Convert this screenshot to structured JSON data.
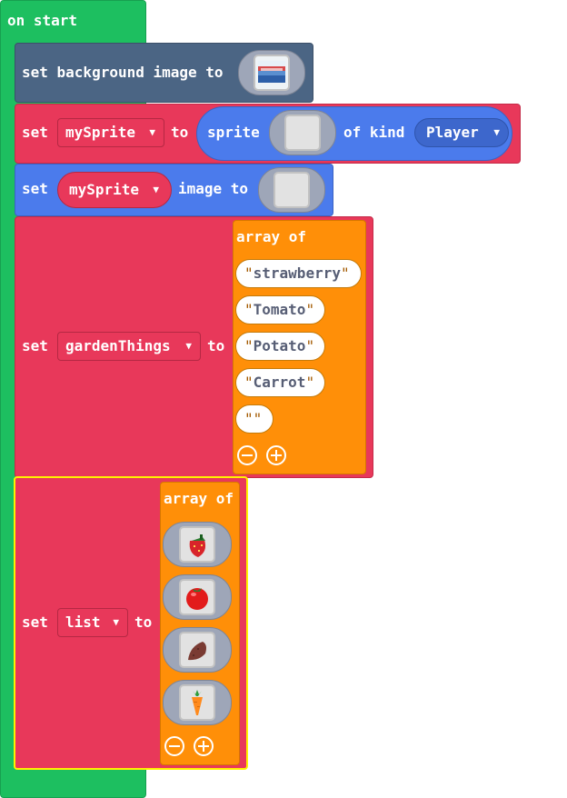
{
  "hat": {
    "label": "on start"
  },
  "bg_block": {
    "label": "set background image to",
    "image_icon": "image-thumbnail-icon"
  },
  "sprite_block": {
    "set": "set",
    "var": "mySprite",
    "to": "to",
    "sprite": "sprite",
    "of_kind": "of kind",
    "kind": "Player"
  },
  "image_block": {
    "set": "set",
    "var": "mySprite",
    "image_to": "image to"
  },
  "garden_block": {
    "set": "set",
    "var": "gardenThings",
    "to": "to",
    "array_label": "array of",
    "items": [
      "strawberry",
      "Tomato",
      "Potato",
      "Carrot",
      ""
    ]
  },
  "list_block": {
    "set": "set",
    "var": "list",
    "to": "to",
    "array_label": "array of",
    "images": [
      "strawberry-icon",
      "tomato-icon",
      "potato-icon",
      "carrot-icon"
    ]
  },
  "colors": {
    "events": "#1db954",
    "scene": "#4b6584",
    "sprites": "#4b7bec",
    "variables": "#eb3b5a",
    "arrays": "#ff8f08",
    "selected_outline": "#fff200"
  }
}
